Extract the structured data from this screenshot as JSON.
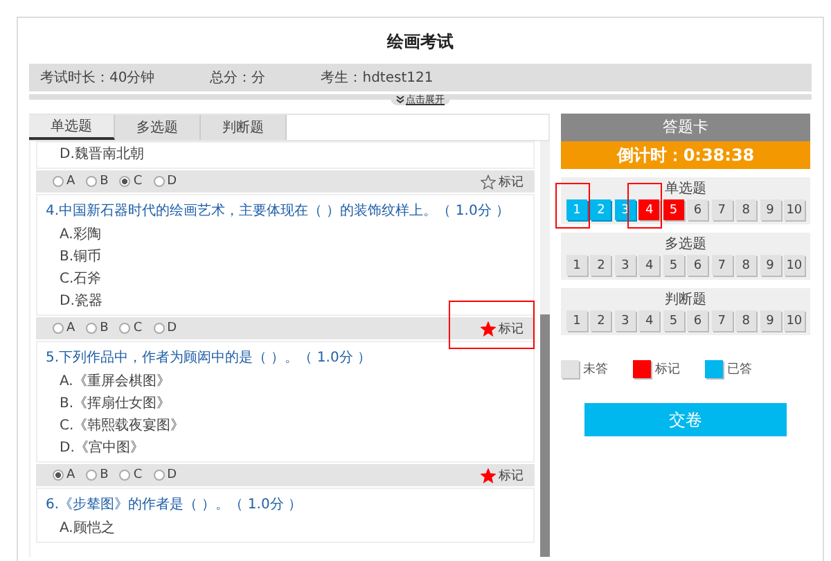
{
  "title": "绘画考试",
  "info": [
    {
      "label": "考试时长：40分钟"
    },
    {
      "label": "总分：分"
    },
    {
      "label": "考生：hdtest121"
    }
  ],
  "expand_toggle": "点击展开",
  "tabs": [
    {
      "label": "单选题",
      "selected": true
    },
    {
      "label": "多选题",
      "selected": false
    },
    {
      "label": "判断题",
      "selected": false
    }
  ],
  "questions": [
    {
      "options": [
        "D.魏晋南北朝"
      ],
      "answer": {
        "choices": [
          {
            "label": "A",
            "selected": false
          },
          {
            "label": "B",
            "selected": false
          },
          {
            "label": "C",
            "selected": true
          },
          {
            "label": "D",
            "selected": false
          }
        ],
        "mark_label": "标记",
        "marked": false,
        "annotated": false
      }
    },
    {
      "title": "4.中国新石器时代的绘画艺术，主要体现在（  ）的装饰纹样上。（ 1.0分 ）",
      "options": [
        "A.彩陶",
        "B.铜币",
        "C.石斧",
        "D.瓷器"
      ],
      "answer": {
        "choices": [
          {
            "label": "A",
            "selected": false
          },
          {
            "label": "B",
            "selected": false
          },
          {
            "label": "C",
            "selected": false
          },
          {
            "label": "D",
            "selected": false
          }
        ],
        "mark_label": "标记",
        "marked": true,
        "annotated": true
      }
    },
    {
      "title": "5.下列作品中，作者为顾闳中的是（  ）。（ 1.0分 ）",
      "options": [
        "A.《重屏会棋图》",
        "B.《挥扇仕女图》",
        "C.《韩熙载夜宴图》",
        "D.《宫中图》"
      ],
      "answer": {
        "choices": [
          {
            "label": "A",
            "selected": true
          },
          {
            "label": "B",
            "selected": false
          },
          {
            "label": "C",
            "selected": false
          },
          {
            "label": "D",
            "selected": false
          }
        ],
        "mark_label": "标记",
        "marked": true,
        "annotated": false
      }
    },
    {
      "title": "6.《步辇图》的作者是（  ）。（ 1.0分 ）",
      "options": [
        "A.顾恺之"
      ]
    }
  ],
  "card": {
    "title": "答题卡",
    "timer": "倒计时：0:38:38",
    "sections": [
      {
        "label": "单选题",
        "items": [
          {
            "number": "1",
            "answered": true,
            "marked": false,
            "annotated": true
          },
          {
            "number": "2",
            "answered": true,
            "marked": false,
            "annotated": false
          },
          {
            "number": "3",
            "answered": true,
            "marked": false,
            "annotated": false
          },
          {
            "number": "4",
            "answered": false,
            "marked": true,
            "annotated": true
          },
          {
            "number": "5",
            "answered": false,
            "marked": true,
            "annotated": false
          },
          {
            "number": "6",
            "answered": false,
            "marked": false,
            "annotated": false
          },
          {
            "number": "7",
            "answered": false,
            "marked": false,
            "annotated": false
          },
          {
            "number": "8",
            "answered": false,
            "marked": false,
            "annotated": false
          },
          {
            "number": "9",
            "answered": false,
            "marked": false,
            "annotated": false
          },
          {
            "number": "10",
            "answered": false,
            "marked": false,
            "annotated": false
          }
        ]
      },
      {
        "label": "多选题",
        "items": [
          {
            "number": "1",
            "answered": false,
            "marked": false,
            "annotated": false
          },
          {
            "number": "2",
            "answered": false,
            "marked": false,
            "annotated": false
          },
          {
            "number": "3",
            "answered": false,
            "marked": false,
            "annotated": false
          },
          {
            "number": "4",
            "answered": false,
            "marked": false,
            "annotated": false
          },
          {
            "number": "5",
            "answered": false,
            "marked": false,
            "annotated": false
          },
          {
            "number": "6",
            "answered": false,
            "marked": false,
            "annotated": false
          },
          {
            "number": "7",
            "answered": false,
            "marked": false,
            "annotated": false
          },
          {
            "number": "8",
            "answered": false,
            "marked": false,
            "annotated": false
          },
          {
            "number": "9",
            "answered": false,
            "marked": false,
            "annotated": false
          },
          {
            "number": "10",
            "answered": false,
            "marked": false,
            "annotated": false
          }
        ]
      },
      {
        "label": "判断题",
        "items": [
          {
            "number": "1",
            "answered": false,
            "marked": false,
            "annotated": false
          },
          {
            "number": "2",
            "answered": false,
            "marked": false,
            "annotated": false
          },
          {
            "number": "3",
            "answered": false,
            "marked": false,
            "annotated": false
          },
          {
            "number": "4",
            "answered": false,
            "marked": false,
            "annotated": false
          },
          {
            "number": "5",
            "answered": false,
            "marked": false,
            "annotated": false
          },
          {
            "number": "6",
            "answered": false,
            "marked": false,
            "annotated": false
          },
          {
            "number": "7",
            "answered": false,
            "marked": false,
            "annotated": false
          },
          {
            "number": "8",
            "answered": false,
            "marked": false,
            "annotated": false
          },
          {
            "number": "9",
            "answered": false,
            "marked": false,
            "annotated": false
          },
          {
            "number": "10",
            "answered": false,
            "marked": false,
            "annotated": false
          }
        ]
      }
    ],
    "legend": [
      {
        "label": "未答",
        "color": "#e2e2e2"
      },
      {
        "label": "标记",
        "color": "#ff0000"
      },
      {
        "label": "已答",
        "color": "#00b7ee"
      }
    ],
    "submit": "交卷"
  }
}
